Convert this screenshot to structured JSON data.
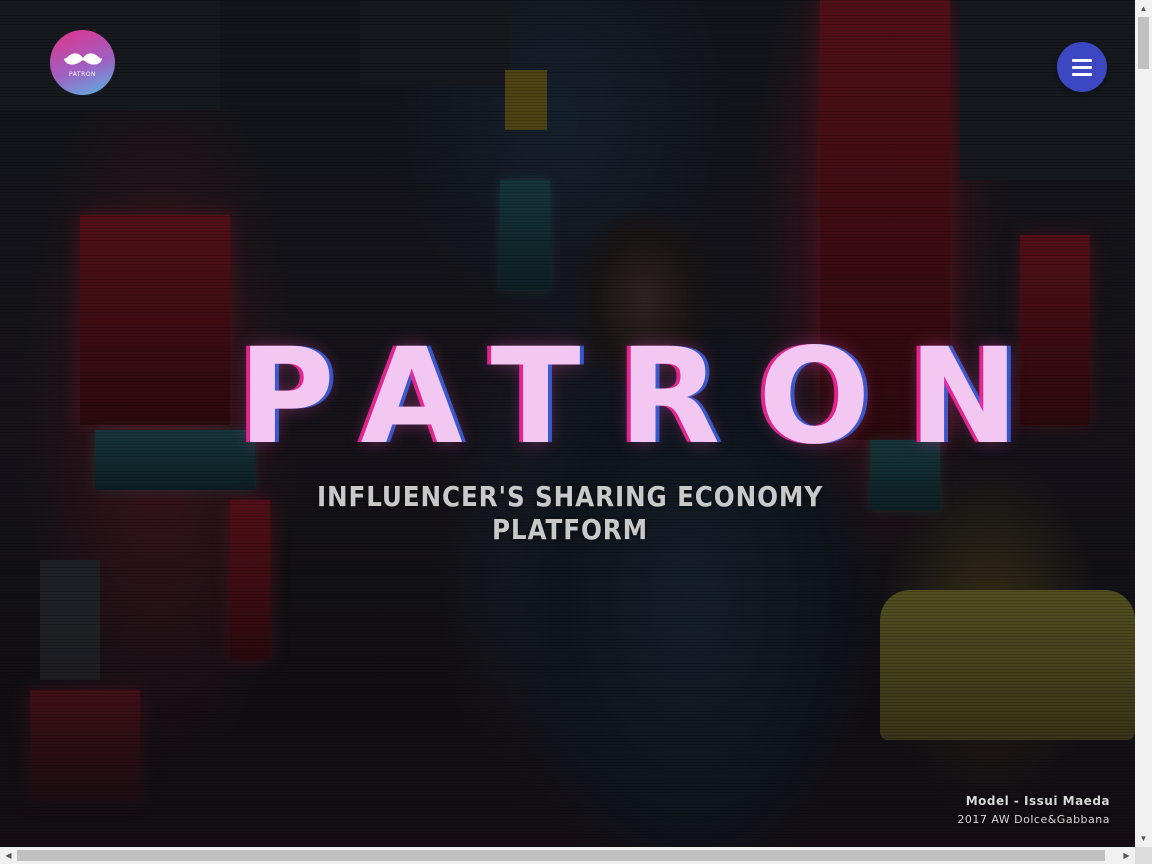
{
  "logo": {
    "name": "PATRON",
    "icon": "mustache-icon"
  },
  "menu": {
    "icon": "hamburger-menu-icon"
  },
  "hero": {
    "title": "PATRON",
    "tagline": "INFLUENCER'S SHARING ECONOMY PLATFORM"
  },
  "credits": {
    "model": "Model - Issui Maeda",
    "season": "2017 AW Dolce&Gabbana"
  },
  "scrollbars": {
    "up_icon": "▲",
    "down_icon": "▼",
    "left_icon": "◀",
    "right_icon": "▶"
  },
  "colors": {
    "menu_button": "#3b48c2",
    "logo_gradient_start": "#e0338a",
    "logo_gradient_end": "#55b7e6",
    "title_glow_pink": "#ff28a0",
    "title_glow_blue": "#3c6eff"
  }
}
